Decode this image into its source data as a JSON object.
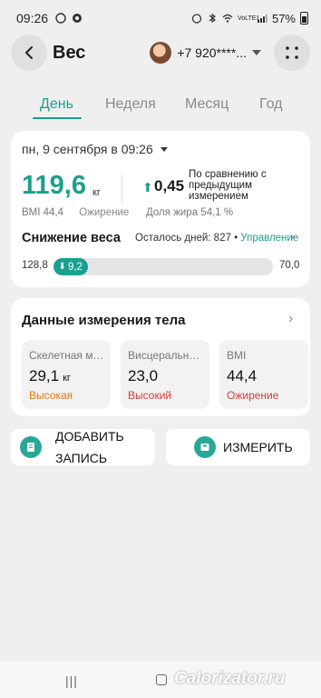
{
  "status_bar": {
    "time": "09:26",
    "battery": "57%",
    "network": "VoLTE1"
  },
  "header": {
    "title": "Вес",
    "account": "+7 920****..."
  },
  "tabs": [
    "День",
    "Неделя",
    "Месяц",
    "Год"
  ],
  "active_tab": "День",
  "measurement": {
    "date": "пн, 9 сентября в 09:26",
    "weight": "119,6",
    "unit": "кг",
    "delta": "0,45",
    "compare": "По сравнению с предыдущим измерением",
    "bmi": "BMI 44,4",
    "bmi_status": "Ожирение",
    "fat": "Доля жира 54,1 %"
  },
  "weight_loss": {
    "title": "Снижение веса",
    "days_left": "Осталось дней: 827",
    "separator": "•",
    "manage": "Управление",
    "start": "128,8",
    "current": "9,2",
    "target": "70,0",
    "progress": 0.155
  },
  "body_data": {
    "title": "Данные измерения тела",
    "metrics": [
      {
        "label": "Скелетная мышечная масса",
        "value": "29,1",
        "unit": "кг",
        "status": "Высокая",
        "color": "#e07a10"
      },
      {
        "label": "Висцеральный жир",
        "value": "23,0",
        "unit": "",
        "status": "Высокий",
        "color": "#d63c3c"
      },
      {
        "label": "BMI",
        "value": "44,4",
        "unit": "",
        "status": "Ожирение",
        "color": "#d63c3c"
      }
    ]
  },
  "actions": {
    "add": "ДОБАВИТЬ ЗАПИСЬ",
    "measure": "ИЗМЕРИТЬ"
  },
  "watermark": "Calorizator.ru",
  "colors": {
    "accent": "#1aa08e",
    "warning": "#e07a10",
    "danger": "#d63c3c"
  }
}
